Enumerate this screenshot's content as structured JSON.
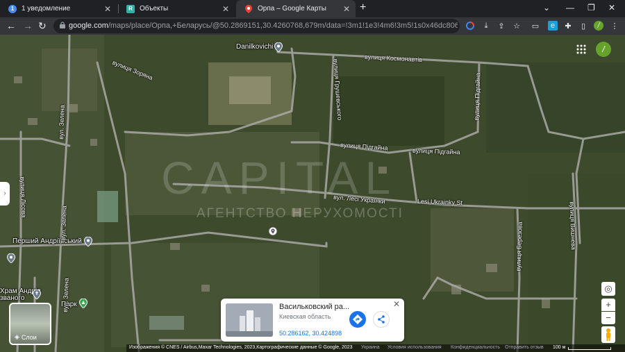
{
  "browser": {
    "tabs": [
      {
        "title": "1 уведомление",
        "favicon": "notification-icon",
        "badge": "1"
      },
      {
        "title": "Объекты",
        "favicon": "r-app-icon",
        "badge": "R"
      },
      {
        "title": "Орпа – Google Карты",
        "favicon": "google-maps-icon",
        "active": true
      }
    ],
    "url_host": "google.com",
    "url_path": "/maps/place/Орпа,+Беларусь/@50.2869151,30.4260768,679m/data=!3m1!1e3!4m6!3m5!1s0x46dc8066aeafa205:0x..."
  },
  "map": {
    "place_labels": {
      "danilkovichi": "Danilkovichi",
      "pershyi": "Перший Андріївський",
      "park": "Парк",
      "khram": "Храм Андрія\nзваного"
    },
    "road_labels": {
      "zoryana": "вулиця Зоряна",
      "kosmonavtiv": "вулиця Космонавтів",
      "grushevskogo": "вулиця Грушевського",
      "pidgaina_v": "вулиця Підгайна",
      "pidgaina1": "вулиця Підгайна",
      "pidgaina2": "вулиця Підгайна",
      "zelena1": "вул. Зелена",
      "zelena2": "вул. Зелена",
      "zelena3": "вул. Зелена",
      "lisova": "вулиця Лісова",
      "lesi": "вул. Лесі Українки",
      "lesi_en": "Lesi Ukrainky St",
      "berezova": "вулиця Березова",
      "vyshneva": "вулиця Вишнева"
    },
    "watermark": "CAPITAL",
    "watermark_sub": "АГЕНТСТВО НЕРУХОМОСТІ",
    "layers_label": "Слои"
  },
  "place_card": {
    "title": "Васильковский ра...",
    "region": "Киевская область",
    "coords": "50.286162, 30.424898"
  },
  "footer": {
    "imagery": "Изображения © CNES / Airbus,Maxar Technologies, 2023,Картографические данные © Google, 2023",
    "country": "Украина",
    "terms": "Условия использования",
    "privacy": "Конфиденциальность",
    "feedback": "Отправить отзыв",
    "scale": "100 м"
  },
  "user": {
    "avatar_letter": "/"
  }
}
